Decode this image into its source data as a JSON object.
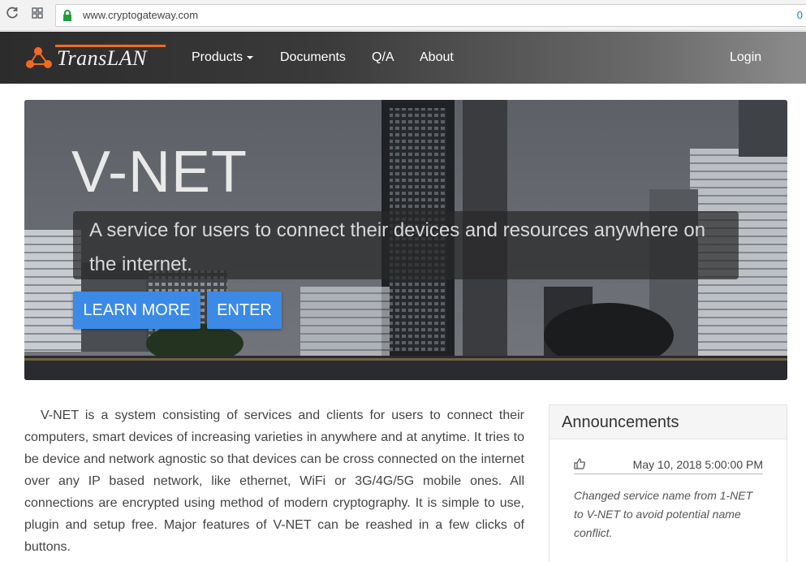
{
  "browser": {
    "url": "www.cryptogateway.com",
    "url_right": "0",
    "icons": [
      "reload-icon",
      "apps-icon",
      "lock-icon"
    ]
  },
  "navbar": {
    "brand": "TransLAN",
    "items": [
      {
        "label": "Products",
        "has_dropdown": true
      },
      {
        "label": "Documents"
      },
      {
        "label": "Q/A"
      },
      {
        "label": "About"
      }
    ],
    "login": "Login",
    "accent": "#f26a21"
  },
  "hero": {
    "title": "V-NET",
    "tagline": "A service for users to connect their devices and resources anywhere on the internet.",
    "buttons": {
      "learn_more": "LEARN MORE",
      "enter": "ENTER"
    },
    "button_color": "#3b8ae6"
  },
  "intro": {
    "text": "V-NET is a system consisting of services and clients for users to connect their computers, smart devices of increasing varieties in anywhere and at anytime. It tries to be device and network agnostic so that devices can be cross connected on the internet over any IP based network, like ethernet, WiFi or 3G/4G/5G mobile ones. All connections are encrypted using method of modern cryptography. It is simple to use, plugin and setup free. Major features of V-NET can be reashed in a few clicks of buttons."
  },
  "announcements": {
    "title": "Announcements",
    "items": [
      {
        "icon": "thumbs-up-icon",
        "date": "May 10, 2018 5:00:00 PM",
        "text": "Changed service name from 1-NET to V-NET to avoid potential name conflict."
      }
    ]
  }
}
